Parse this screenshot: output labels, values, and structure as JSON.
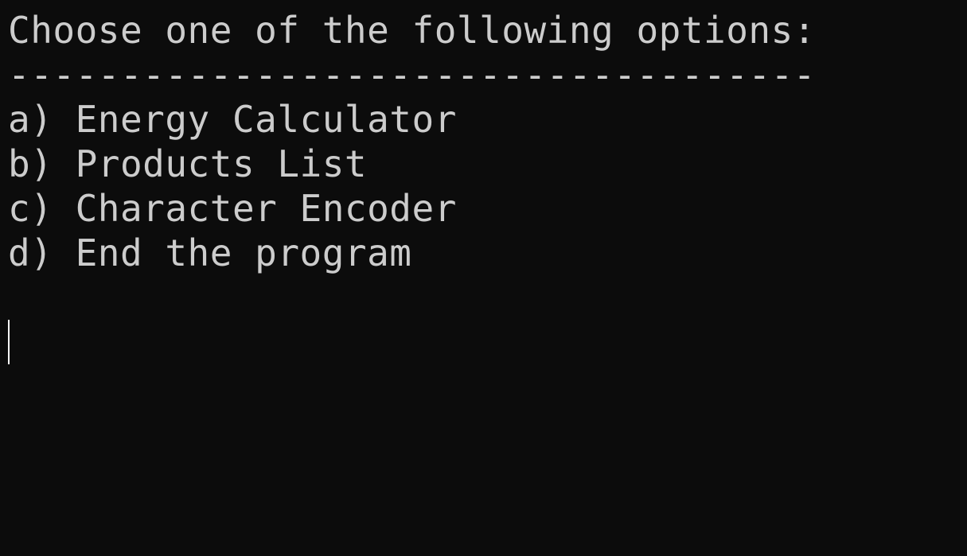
{
  "terminal": {
    "background": "#0c0c0c",
    "foreground": "#cccccc",
    "prompt": "Choose one of the following options:",
    "separator": "------------------------------------",
    "options": [
      "a) Energy Calculator",
      "b) Products List",
      "c) Character Encoder",
      "d) End the program"
    ],
    "input_value": ""
  }
}
